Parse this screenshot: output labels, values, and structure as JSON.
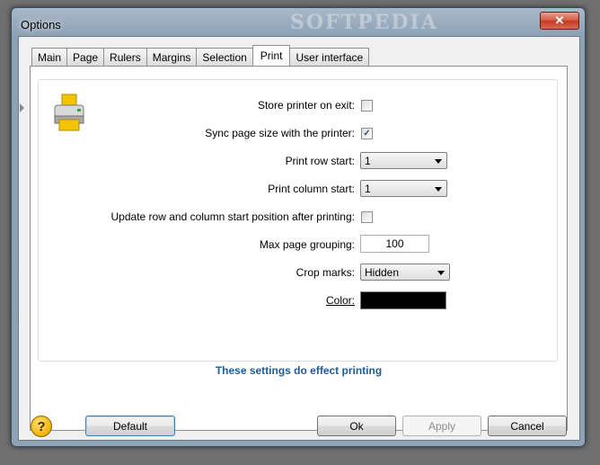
{
  "window": {
    "title": "Options",
    "close": "✕",
    "watermark": "SOFTPEDIA"
  },
  "tabs": [
    {
      "label": "Main",
      "active": false
    },
    {
      "label": "Page",
      "active": false
    },
    {
      "label": "Rulers",
      "active": false
    },
    {
      "label": "Margins",
      "active": false
    },
    {
      "label": "Selection",
      "active": false
    },
    {
      "label": "Print",
      "active": true
    },
    {
      "label": "User interface",
      "active": false
    }
  ],
  "print": {
    "store_printer": {
      "label": "Store printer on exit:",
      "checked": false
    },
    "sync_page_size": {
      "label": "Sync page size with the printer:",
      "checked": true
    },
    "row_start": {
      "label": "Print row start:",
      "value": "1"
    },
    "column_start": {
      "label": "Print column start:",
      "value": "1"
    },
    "update_start": {
      "label": "Update row and column start position after printing:",
      "checked": false
    },
    "max_grouping": {
      "label": "Max page grouping:",
      "value": "100"
    },
    "crop_marks": {
      "label": "Crop marks:",
      "value": "Hidden"
    },
    "color": {
      "label": "Color:",
      "value": "#000000"
    },
    "note": "These settings do effect printing"
  },
  "buttons": {
    "default": "Default",
    "ok": "Ok",
    "apply": "Apply",
    "cancel": "Cancel"
  },
  "icons": {
    "help": "?",
    "checkmark": "✓"
  },
  "colors": {
    "accent_text": "#1c5d99",
    "swatch": "#000000"
  }
}
